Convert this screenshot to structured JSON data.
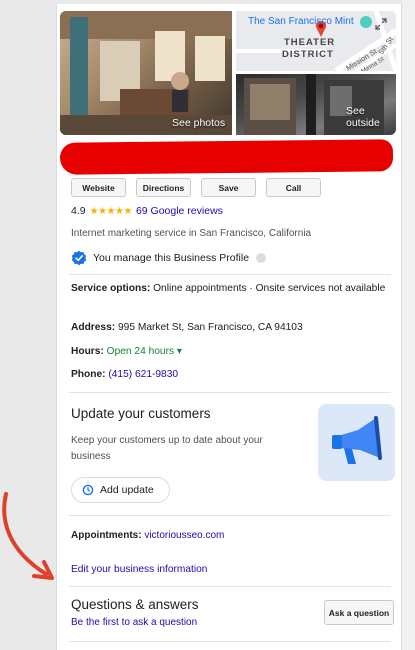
{
  "photos": {
    "see_photos": "See photos",
    "see_outside": "See outside",
    "map_place": "The San Francisco Mint",
    "map_district_line1": "THEATER",
    "map_district_line2": "DISTRICT",
    "map_street1": "Mission St",
    "map_street2": "5th St",
    "map_street3": "Minna St"
  },
  "actions": [
    "Website",
    "Directions",
    "Save",
    "Call"
  ],
  "rating": {
    "score": "4.9",
    "stars": "★★★★★",
    "reviews_link": "69 Google reviews"
  },
  "category": "Internet marketing service in San Francisco, California",
  "manage": {
    "text": "You manage this Business Profile"
  },
  "service": {
    "label": "Service options:",
    "value": "Online appointments · Onsite services not available"
  },
  "address": {
    "label": "Address:",
    "value": "995 Market St, San Francisco, CA 94103"
  },
  "hours": {
    "label": "Hours:",
    "value": "Open 24 hours ▾"
  },
  "phone": {
    "label": "Phone:",
    "value": "(415) 621-9830"
  },
  "update": {
    "title": "Update your customers",
    "description": "Keep your customers up to date about your business",
    "button": "Add update"
  },
  "appointments": {
    "label": "Appointments:",
    "link": "victoriousseo.com"
  },
  "edit_link": "Edit your business information",
  "qa": {
    "title": "Questions & answers",
    "subtitle": "Be the first to ask a question",
    "ask_button": "Ask a question"
  },
  "colors": {
    "link": "#1a0dab",
    "star": "#f4b400",
    "open_green": "#188038",
    "redaction": "#e60000",
    "verified_blue": "#1a73e8",
    "annotation_arrow": "#e0402b"
  }
}
